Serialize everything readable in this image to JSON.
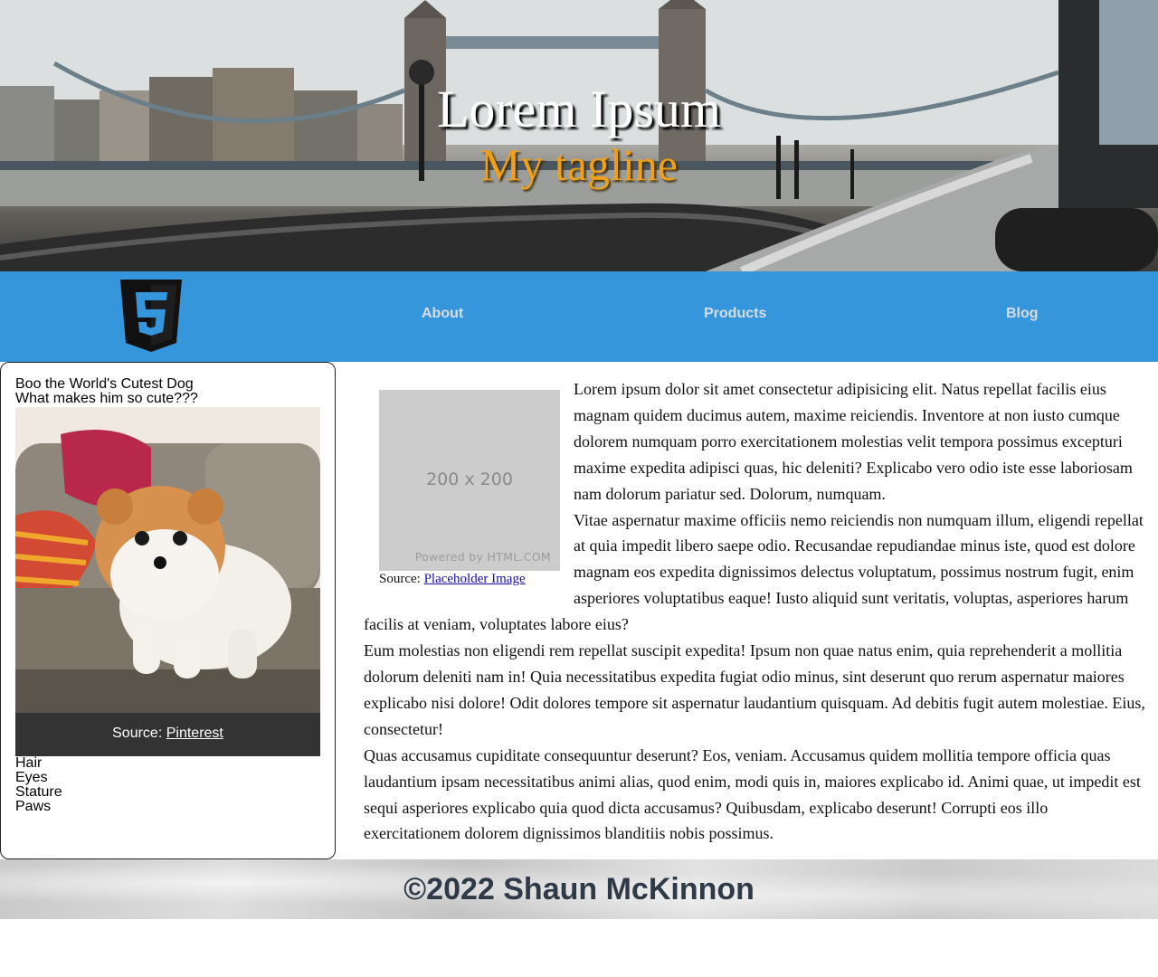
{
  "hero": {
    "title": "Lorem Ipsum",
    "tagline": "My tagline",
    "image": "london-tower-bridge-photo"
  },
  "nav": {
    "logo_icon": "html5-logo-icon",
    "links": [
      "About",
      "Products",
      "Blog"
    ]
  },
  "sidebar": {
    "heading": "Boo the World's Cutest Dog",
    "subheading": "What makes him so cute???",
    "photo": "pomeranian-dog-photo",
    "caption_prefix": "Source: ",
    "caption_link": "Pinterest",
    "traits": [
      "Hair",
      "Eyes",
      "Stature",
      "Paws"
    ]
  },
  "main": {
    "placeholder": {
      "dimensions": "200 x 200",
      "powered_by": "Powered by HTML.COM"
    },
    "figure_source_prefix": "Source: ",
    "figure_source_link": "Placeholder Image",
    "paragraphs": [
      "Lorem ipsum dolor sit amet consectetur adipisicing elit. Natus repellat facilis eius magnam quidem ducimus autem, maxime reiciendis. Inventore at non iusto cumque dolorem numquam porro exercitationem molestias velit tempora possimus excepturi maxime expedita adipisci quas, hic deleniti? Explicabo vero odio iste esse laboriosam nam dolorum pariatur sed. Dolorum, numquam.",
      "Vitae aspernatur maxime officiis nemo reiciendis non numquam illum, eligendi repellat at quia impedit libero saepe odio. Recusandae repudiandae minus iste, quod est dolore magnam eos expedita dignissimos delectus voluptatum, possimus nostrum fugit, enim asperiores voluptatibus eaque! Iusto aliquid sunt veritatis, voluptas, asperiores harum facilis at veniam, voluptates labore eius?",
      "Eum molestias non eligendi rem repellat suscipit expedita! Ipsum non quae natus enim, quia reprehenderit a mollitia dolorum deleniti nam in! Quia necessitatibus expedita fugiat odio minus, sint deserunt quo rerum aspernatur maiores explicabo nisi dolore! Odit dolores tempore sit aspernatur laudantium quisquam. Ad debitis fugit autem molestiae. Eius, consectetur!",
      "Quas accusamus cupiditate consequuntur deserunt? Eos, veniam. Accusamus quidem mollitia tempore officia quas laudantium ipsam necessitatibus animi alias, quod enim, modi quis in, maiores explicabo id. Animi quae, ut impedit est sequi asperiores explicabo quia quod dicta accusamus? Quibusdam, explicabo deserunt! Corrupti eos illo exercitationem dolorem dignissimos blanditiis nobis possimus."
    ]
  },
  "footer": {
    "copyright": "©2022 Shaun McKinnon"
  },
  "colors": {
    "nav_background": "#3596db",
    "nav_link": "#d8dde3",
    "tagline": "#f0a01b",
    "caption_bar": "#333333",
    "footer_text": "#2e3a48"
  }
}
